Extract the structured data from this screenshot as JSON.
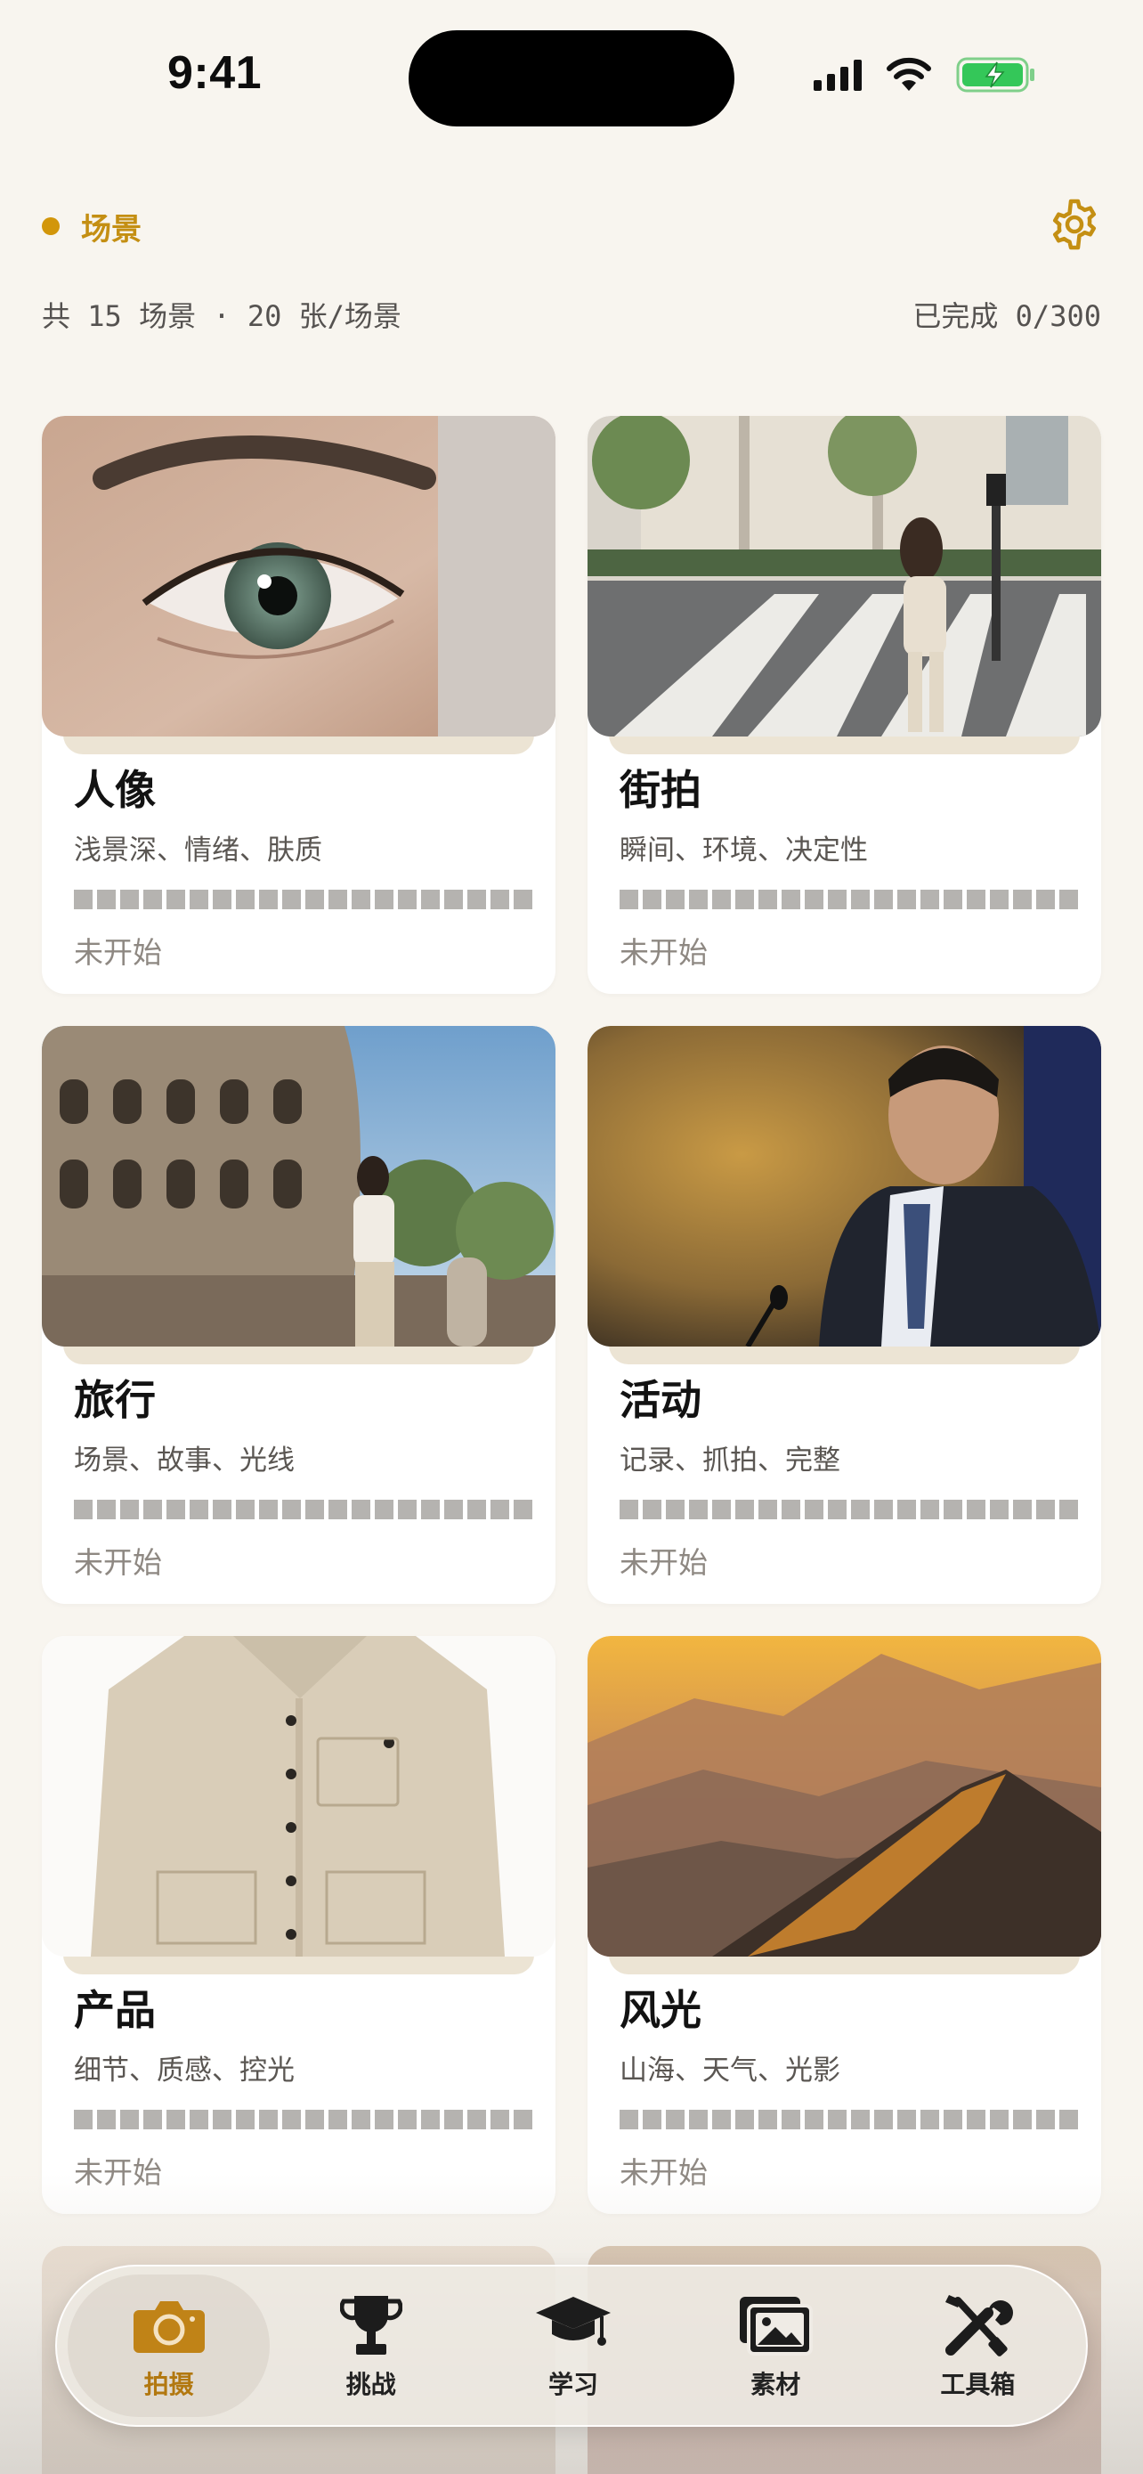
{
  "status_bar": {
    "time": "9:41"
  },
  "header": {
    "section_label": "场景"
  },
  "stats": {
    "summary": "共 15 场景 · 20 张/场景",
    "completed": "已完成 0/300"
  },
  "colors": {
    "accent": "#c48f13",
    "background": "#f8f5ef",
    "progress_empty": "#b5b3b0"
  },
  "scenes": [
    {
      "title": "人像",
      "subtitle": "浅景深、情绪、肤质",
      "status": "未开始",
      "photo": "eye-closeup"
    },
    {
      "title": "街拍",
      "subtitle": "瞬间、环境、决定性",
      "status": "未开始",
      "photo": "street-crosswalk"
    },
    {
      "title": "旅行",
      "subtitle": "场景、故事、光线",
      "status": "未开始",
      "photo": "colosseum-woman"
    },
    {
      "title": "活动",
      "subtitle": "记录、抓拍、完整",
      "status": "未开始",
      "photo": "speaker-podium"
    },
    {
      "title": "产品",
      "subtitle": "细节、质感、控光",
      "status": "未开始",
      "photo": "beige-jacket"
    },
    {
      "title": "风光",
      "subtitle": "山海、天气、光影",
      "status": "未开始",
      "photo": "mountain-sunset"
    }
  ],
  "progress_segments": 20,
  "progress_filled": 0,
  "tabs": [
    {
      "label": "拍摄",
      "icon": "camera-icon",
      "active": true
    },
    {
      "label": "挑战",
      "icon": "trophy-icon",
      "active": false
    },
    {
      "label": "学习",
      "icon": "graduation-cap-icon",
      "active": false
    },
    {
      "label": "素材",
      "icon": "gallery-icon",
      "active": false
    },
    {
      "label": "工具箱",
      "icon": "tools-icon",
      "active": false
    }
  ]
}
